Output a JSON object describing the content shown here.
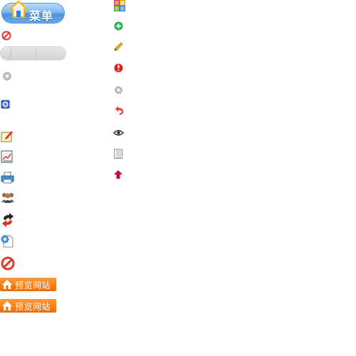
{
  "menu": {
    "label": "菜单",
    "icon": "home-icon"
  },
  "preview_buttons": [
    {
      "label": "预览网站",
      "icon": "home-icon"
    },
    {
      "label": "预览网站",
      "icon": "home-icon"
    }
  ],
  "left_icons": [
    "forbidden-icon",
    "settings-gear-icon",
    "radio-button-icon",
    "edit-note-icon",
    "chart-document-icon",
    "printer-icon",
    "user-group-icon",
    "refresh-arrows-icon",
    "page-settings-icon",
    "stop-icon"
  ],
  "right_icons": [
    "grid-apps-icon",
    "add-icon",
    "pencil-icon",
    "power-icon",
    "gear-icon",
    "undo-icon",
    "view-eye-icon",
    "list-document-icon",
    "upload-arrow-icon"
  ],
  "colors": {
    "menu_blue": "#4f90d9",
    "orange": "#f26b00",
    "add_green": "#22b14c",
    "forbidden_red": "#e03a2a"
  }
}
